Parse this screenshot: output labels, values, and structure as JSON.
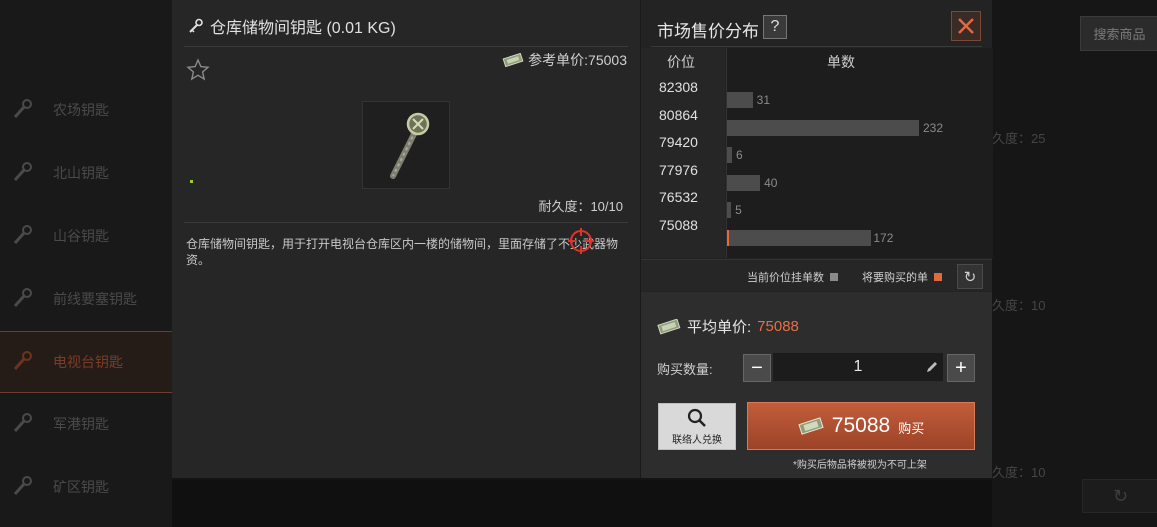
{
  "background_list": {
    "items": [
      {
        "label": "农场钥匙"
      },
      {
        "label": "北山钥匙"
      },
      {
        "label": "山谷钥匙"
      },
      {
        "label": "前线要塞钥匙"
      },
      {
        "label": "电视台钥匙"
      },
      {
        "label": "军港钥匙"
      },
      {
        "label": "矿区钥匙"
      }
    ],
    "active_index": 4,
    "search_label": "搜索商品",
    "durability_labels": [
      "久度：25",
      "久度：10",
      "久度：10"
    ]
  },
  "item": {
    "title": "仓库储物间钥匙 (0.01 KG)",
    "ref_price": "参考单价:75003",
    "durability": "耐久度：10/10",
    "description": "仓库储物间钥匙，用于打开电视台仓库区内一楼的储物间，里面存储了不少武器物资。"
  },
  "market": {
    "title": "市场售价分布",
    "help_label": "?",
    "col_price": "价位",
    "col_count": "单数",
    "legend_current": "当前价位挂单数",
    "legend_buy": "将要购买的单",
    "colors": {
      "bar": "#4c4c4c",
      "buy": "#e06a3b"
    }
  },
  "chart_data": {
    "type": "bar",
    "orientation": "horizontal",
    "categories": [
      "82308",
      "80864",
      "79420",
      "77976",
      "76532",
      "75088"
    ],
    "values": [
      31,
      232,
      6,
      40,
      5,
      172
    ],
    "xlabel": "单数",
    "ylabel": "价位",
    "xlim": [
      0,
      232
    ]
  },
  "buy": {
    "avg_label": "平均单价:",
    "avg_value": "75088",
    "qty_label": "购买数量:",
    "qty_value": "1",
    "contact_label": "联络人兑换",
    "price": "75088",
    "buy_label": "购买",
    "note": "*购买后物品将被视为不可上架"
  }
}
